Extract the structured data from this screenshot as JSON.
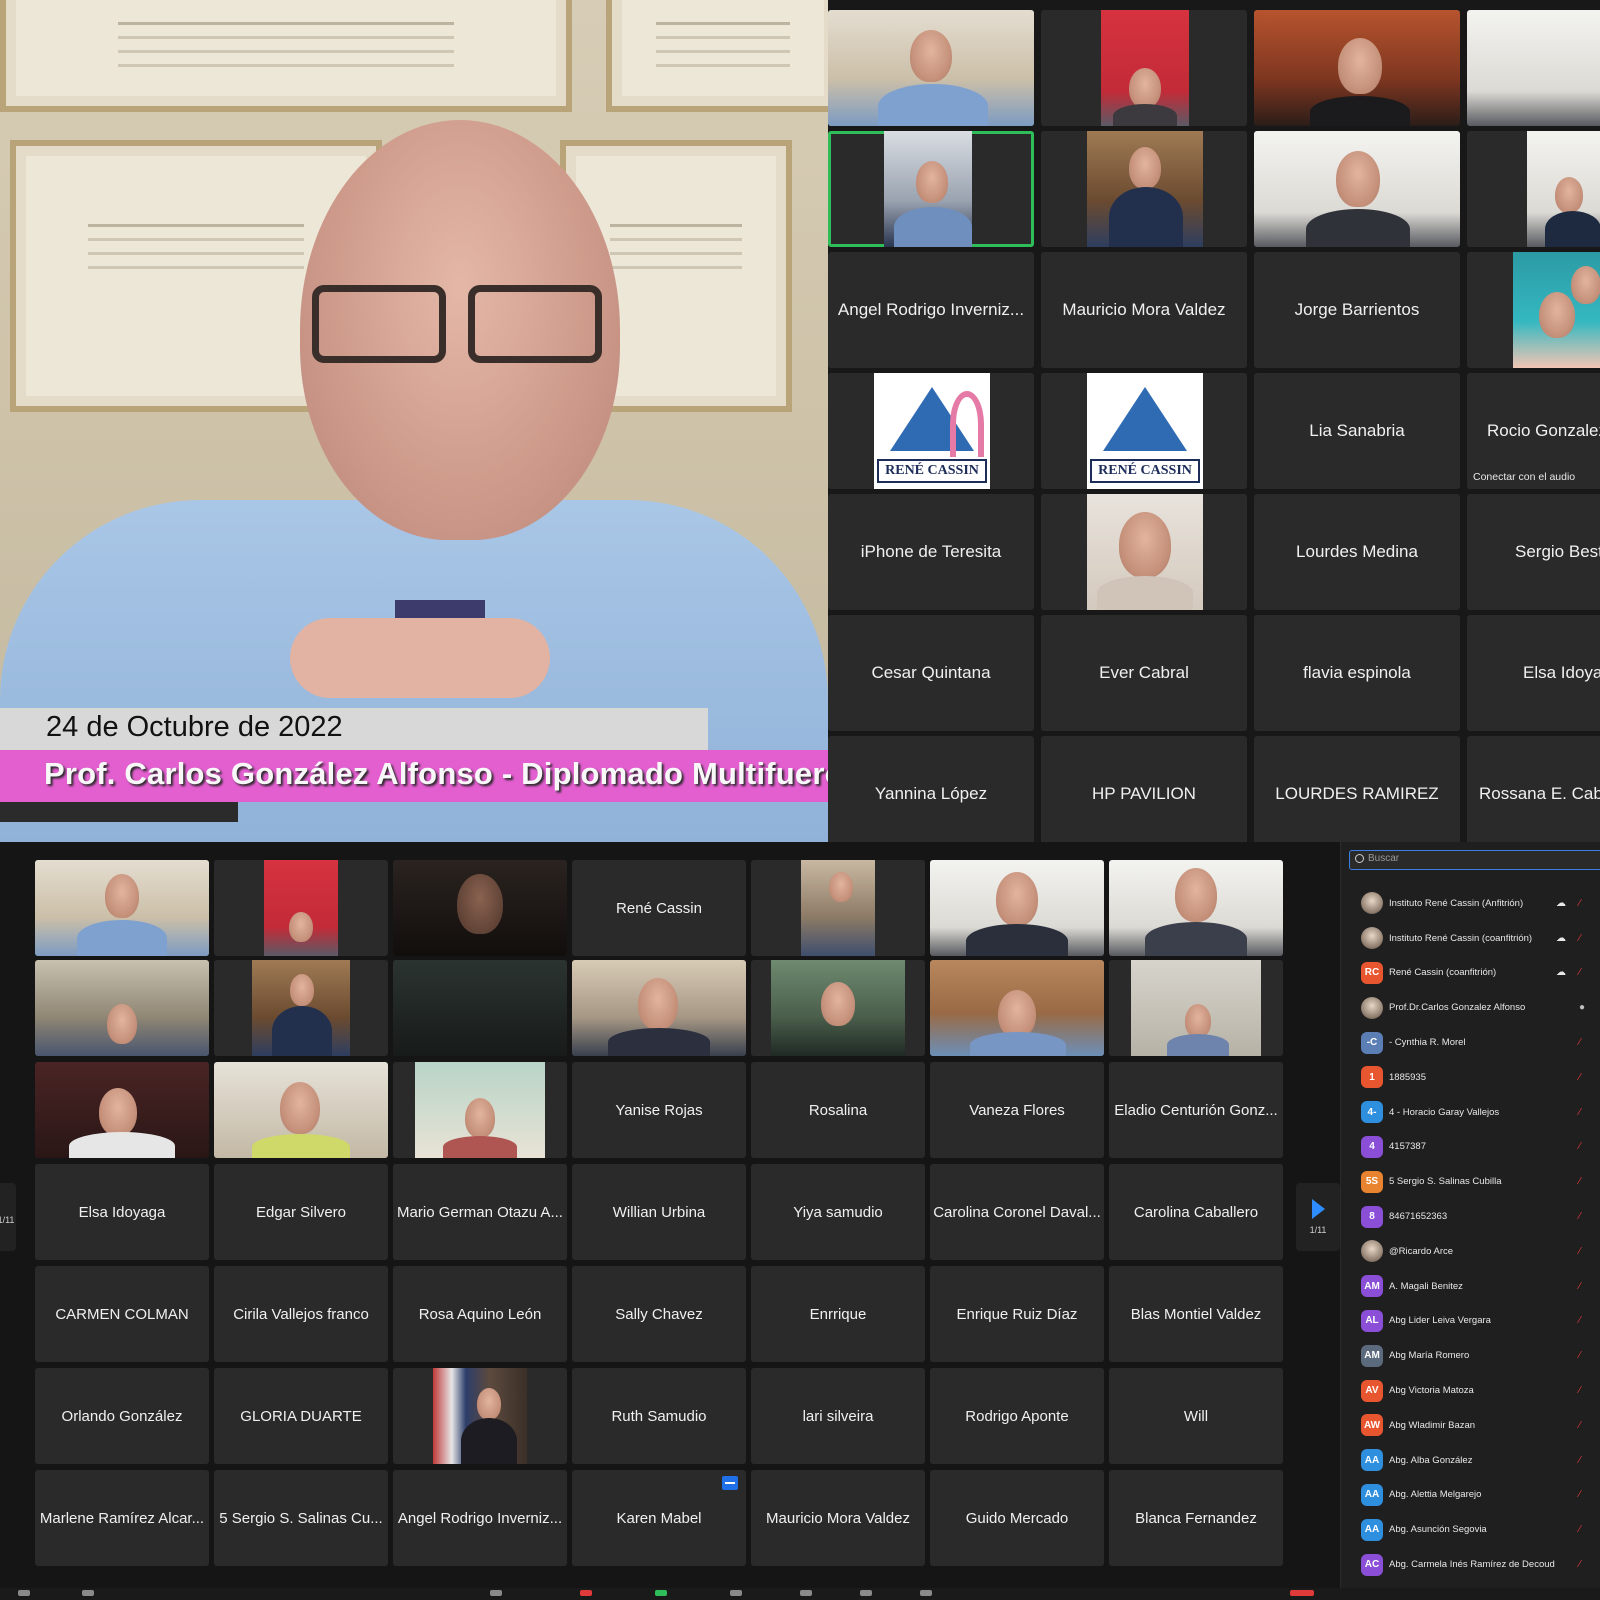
{
  "speaker": {
    "date": "24 de Octubre de 2022",
    "name_banner": "Prof. Carlos González Alfonso - Diplomado Multifuero"
  },
  "top_gallery": {
    "tiles": [
      {
        "name": "Angel Rodrigo Inverniz..."
      },
      {
        "name": "Mauricio Mora Valdez"
      },
      {
        "name": "Jorge Barrientos"
      },
      {
        "name": "Lia Sanabria"
      },
      {
        "name": "Rocio Gonzalez",
        "subtext": "Conectar con el audio"
      },
      {
        "name": "iPhone de Teresita"
      },
      {
        "name": "Lourdes Medina"
      },
      {
        "name": "Sergio Best"
      },
      {
        "name": "Cesar Quintana"
      },
      {
        "name": "Ever Cabral"
      },
      {
        "name": "flavia espinola"
      },
      {
        "name": "Elsa Idoyag"
      },
      {
        "name": "Yannina López"
      },
      {
        "name": "HP PAVILION"
      },
      {
        "name": "LOURDES RAMIREZ"
      },
      {
        "name": "Rossana E. Cabr"
      }
    ],
    "logo_text": "RENÉ CASSIN"
  },
  "bottom_gallery": {
    "tiles": [
      {
        "name": "René Cassin"
      },
      {
        "name": "Yanise Rojas"
      },
      {
        "name": "Rosalina"
      },
      {
        "name": "Vaneza Flores"
      },
      {
        "name": "Eladio Centurión Gonz..."
      },
      {
        "name": "Elsa Idoyaga"
      },
      {
        "name": "Edgar Silvero"
      },
      {
        "name": "Mario German Otazu A..."
      },
      {
        "name": "Willian Urbina"
      },
      {
        "name": "Yiya samudio"
      },
      {
        "name": "Carolina Coronel Daval..."
      },
      {
        "name": "Carolina Caballero"
      },
      {
        "name": "CARMEN COLMAN"
      },
      {
        "name": "Cirila Vallejos franco"
      },
      {
        "name": "Rosa Aquino León"
      },
      {
        "name": "Sally Chavez"
      },
      {
        "name": "Enrrique"
      },
      {
        "name": "Enrique Ruiz Díaz"
      },
      {
        "name": "Blas Montiel Valdez"
      },
      {
        "name": "Orlando González"
      },
      {
        "name": "GLORIA DUARTE"
      },
      {
        "name": "Ruth Samudio"
      },
      {
        "name": "lari silveira"
      },
      {
        "name": "Rodrigo Aponte"
      },
      {
        "name": "Will"
      },
      {
        "name": "Marlene Ramírez Alcar..."
      },
      {
        "name": "5 Sergio S. Salinas Cu..."
      },
      {
        "name": "Angel Rodrigo Inverniz..."
      },
      {
        "name": "Karen Mabel"
      },
      {
        "name": "Mauricio Mora Valdez"
      },
      {
        "name": "Guido Mercado"
      },
      {
        "name": "Blanca Fernandez"
      }
    ],
    "page_indicator": "1/11"
  },
  "participants": {
    "search_placeholder": "Buscar",
    "list": [
      {
        "avatar": "",
        "color": "",
        "name": "Instituto René Cassin (Anfitrión)"
      },
      {
        "avatar": "",
        "color": "",
        "name": "Instituto René Cassin (coanfitrión)"
      },
      {
        "avatar": "RC",
        "color": "#e8562f",
        "name": "René Cassin (coanfitrión)"
      },
      {
        "avatar": "",
        "color": "",
        "name": "Prof.Dr.Carlos Gonzalez Alfonso"
      },
      {
        "avatar": "-C",
        "color": "#5b7fb5",
        "name": "- Cynthia R. Morel"
      },
      {
        "avatar": "1",
        "color": "#e8562f",
        "name": "1885935"
      },
      {
        "avatar": "4-",
        "color": "#2f8fdf",
        "name": "4 - Horacio Garay Vallejos"
      },
      {
        "avatar": "4",
        "color": "#8a4fd6",
        "name": "4157387"
      },
      {
        "avatar": "5S",
        "color": "#e8842f",
        "name": "5 Sergio S. Salinas Cubilla"
      },
      {
        "avatar": "8",
        "color": "#8a4fd6",
        "name": "84671652363"
      },
      {
        "avatar": "",
        "color": "",
        "name": "@Ricardo Arce"
      },
      {
        "avatar": "AM",
        "color": "#8a4fd6",
        "name": "A. Magali Benitez"
      },
      {
        "avatar": "AL",
        "color": "#8a4fd6",
        "name": "Abg Lider Leiva Vergara"
      },
      {
        "avatar": "AM",
        "color": "#5b6a7d",
        "name": "Abg María Romero"
      },
      {
        "avatar": "AV",
        "color": "#e8562f",
        "name": "Abg Victoria Matoza"
      },
      {
        "avatar": "AW",
        "color": "#e8562f",
        "name": "Abg Wladimir Bazan"
      },
      {
        "avatar": "AA",
        "color": "#2f8fdf",
        "name": "Abg. Alba González"
      },
      {
        "avatar": "AA",
        "color": "#2f8fdf",
        "name": "Abg. Alettia Melgarejo"
      },
      {
        "avatar": "AA",
        "color": "#2f8fdf",
        "name": "Abg. Asunción Segovia"
      },
      {
        "avatar": "AC",
        "color": "#8a4fd6",
        "name": "Abg. Carmela Inés Ramírez de Decoud"
      }
    ]
  },
  "colors": {
    "active_speaker": "#2fbd5a",
    "accent": "#2d8cff",
    "banner_pink": "#e35fd0",
    "muted_red": "#e03a3a"
  }
}
